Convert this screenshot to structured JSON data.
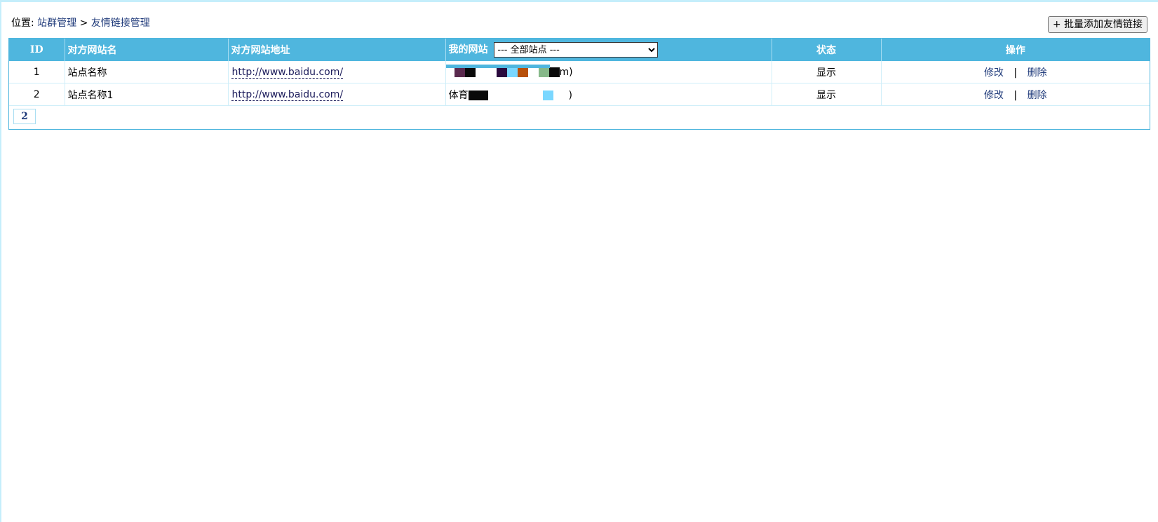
{
  "breadcrumb": {
    "prefix": "位置:",
    "crumb1": "站群管理",
    "separator": ">",
    "crumb2": "友情链接管理"
  },
  "batch_add_button": "+ 批量添加友情链接",
  "table": {
    "headers": {
      "id": "ID",
      "name": "对方网站名",
      "url": "对方网站地址",
      "my_site": "我的网站",
      "status": "状态",
      "actions": "操作"
    },
    "site_filter": {
      "selected": "--- 全部站点 ---"
    },
    "rows": [
      {
        "id": "1",
        "name": "站点名称",
        "url": "http://www.baidu.com/",
        "my_site_visible": "m)",
        "status": "显示",
        "edit": "修改",
        "divider": "|",
        "delete": "删除"
      },
      {
        "id": "2",
        "name": "站点名称1",
        "url": "http://www.baidu.com/",
        "my_site_visible": "体育",
        "my_site_tail": ")",
        "status": "显示",
        "edit": "修改",
        "divider": "|",
        "delete": "删除"
      }
    ]
  },
  "pagination": {
    "current_page": "2"
  },
  "colors": {
    "header_bg": "#4fb6de",
    "link": "#1f3a7a",
    "frame_border": "#c5eefb"
  }
}
